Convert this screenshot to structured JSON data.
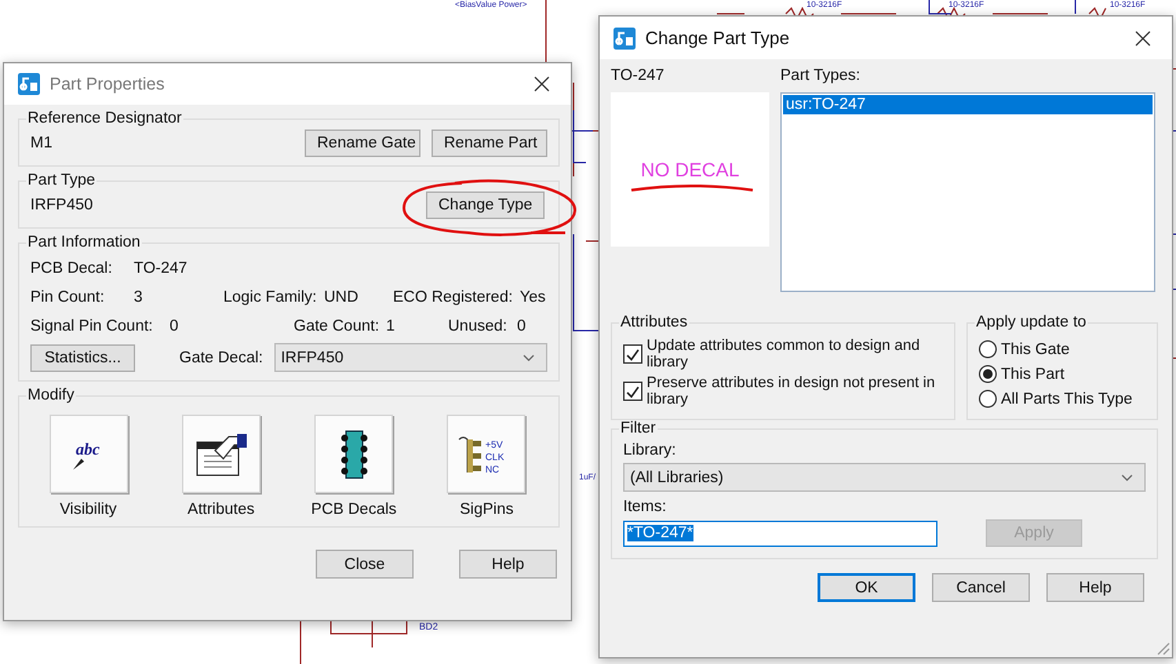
{
  "schematic": {
    "labels": [
      {
        "text": "<BiasValue Power>"
      },
      {
        "text": "10-3216F"
      },
      {
        "text": "10-3216F"
      },
      {
        "text": "10-3216F"
      },
      {
        "text": "1uF/"
      },
      {
        "text": "BD2"
      }
    ]
  },
  "part_properties": {
    "title": "Part Properties",
    "reference_designator": {
      "label": "Reference Designator",
      "value": "M1",
      "buttons": [
        "Rename Gate",
        "Rename Part"
      ]
    },
    "part_type": {
      "label": "Part Type",
      "value": "IRFP450",
      "button": "Change Type"
    },
    "part_information": {
      "label": "Part Information",
      "rows": [
        [
          {
            "label": "PCB Decal:",
            "value": "TO-247"
          }
        ],
        [
          {
            "label": "Pin Count:",
            "value": "3"
          },
          {
            "label": "Logic Family:",
            "value": "UND"
          },
          {
            "label": "ECO Registered:",
            "value": "Yes"
          }
        ],
        [
          {
            "label": "Signal Pin Count:",
            "value": "0"
          },
          {
            "label": "Gate Count:",
            "value": "1"
          },
          {
            "label": "Unused:",
            "value": "0"
          }
        ]
      ],
      "statistics_button": "Statistics...",
      "gate_decal": {
        "label": "Gate Decal:",
        "value": "IRFP450"
      }
    },
    "modify": {
      "label": "Modify",
      "tools": [
        {
          "kind": "visibility",
          "label": "Visibility",
          "glyph": "abc"
        },
        {
          "kind": "attributes",
          "label": "Attributes"
        },
        {
          "kind": "decals",
          "label": "PCB Decals"
        },
        {
          "kind": "sigpins",
          "label": "SigPins",
          "pins": [
            "+5V",
            "CLK",
            "NC"
          ]
        }
      ]
    },
    "buttons": [
      "Close",
      "Help"
    ]
  },
  "change_part_type": {
    "title": "Change Part Type",
    "decal_name": "TO-247",
    "preview_text": "NO DECAL",
    "part_types": {
      "label": "Part Types:",
      "items": [
        {
          "text": "usr:TO-247",
          "selected": true
        }
      ]
    },
    "attributes": {
      "label": "Attributes",
      "options": [
        {
          "text": "Update attributes common to design and library",
          "checked": true
        },
        {
          "text": "Preserve attributes in design not present in library",
          "checked": true
        }
      ]
    },
    "apply_update": {
      "label": "Apply update to",
      "options": [
        {
          "text": "This Gate",
          "selected": false
        },
        {
          "text": "This Part",
          "selected": true
        },
        {
          "text": "All Parts This Type",
          "selected": false
        }
      ]
    },
    "filter": {
      "label": "Filter",
      "library_label": "Library:",
      "library": "(All Libraries)",
      "items_label": "Items:",
      "items": "*TO-247*",
      "apply_button": {
        "text": "Apply",
        "disabled": true
      }
    },
    "buttons": [
      {
        "text": "OK",
        "default": true
      },
      {
        "text": "Cancel",
        "default": false
      },
      {
        "text": "Help",
        "default": false
      }
    ]
  }
}
